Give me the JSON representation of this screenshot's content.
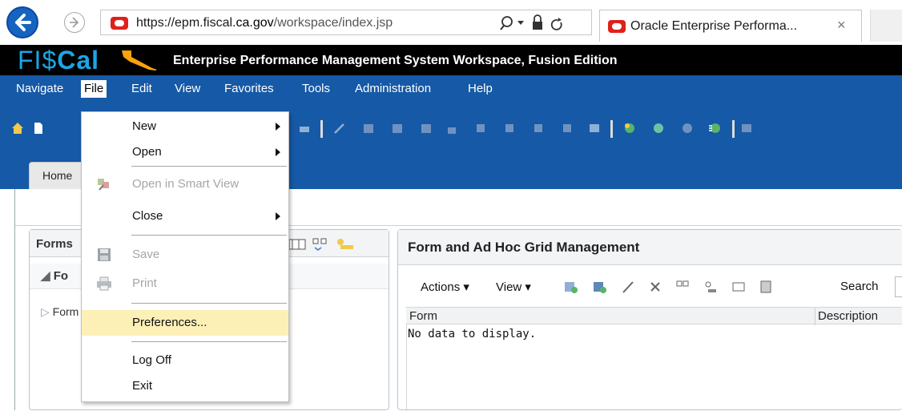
{
  "browser": {
    "url_prefix": "https://epm.fiscal.",
    "url_domain": "ca.gov",
    "url_path": "/workspace/index.jsp",
    "tab_title": "Oracle Enterprise Performa...",
    "tab_close": "×",
    "search_icon": "search-icon",
    "lock_icon": "lock-icon",
    "refresh_icon": "refresh-icon"
  },
  "banner": {
    "logo_part1": "FI$",
    "logo_part2": "Cal",
    "title": "Enterprise Performance Management System Workspace, Fusion Edition"
  },
  "menubar": {
    "items": [
      "Navigate",
      "File",
      "Edit",
      "View",
      "Favorites",
      "Tools",
      "Administration",
      "Help"
    ],
    "active": "File"
  },
  "tabs": {
    "home": "Home"
  },
  "file_menu": {
    "new": "New",
    "open": "Open",
    "open_smart_view": "Open in Smart View",
    "close": "Close",
    "save": "Save",
    "print": "Print",
    "preferences": "Preferences...",
    "log_off": "Log Off",
    "exit": "Exit"
  },
  "left_panel": {
    "title": "Forms",
    "subhead": "Fo",
    "tree_item": "Form"
  },
  "right_panel": {
    "title": "Form and Ad Hoc Grid Management",
    "actions": "Actions",
    "view": "View",
    "search": "Search",
    "col_form": "Form",
    "col_description": "Description",
    "empty": "No data to display."
  },
  "colors": {
    "app_blue": "#1659a6",
    "banner_black": "#000000",
    "logo_blue": "#1aa6e6",
    "hover_yellow": "#fdf0b6",
    "oracle_red": "#e0201b"
  }
}
